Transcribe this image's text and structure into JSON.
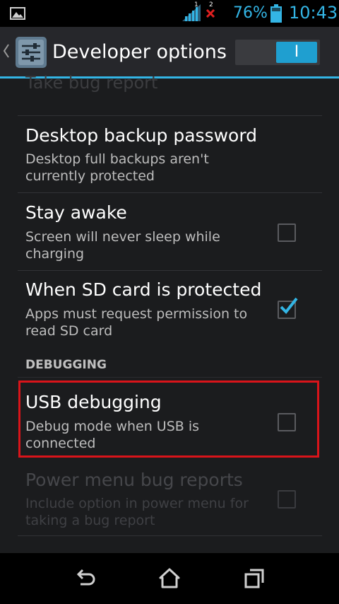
{
  "status_bar": {
    "signal_badge": "1",
    "no_signal_badge": "2",
    "battery_percent": "76%",
    "time": "10:43",
    "accent_color": "#33b5e5"
  },
  "action_bar": {
    "title": "Developer options",
    "master_switch": {
      "label": "I",
      "state": "on"
    }
  },
  "list": {
    "cut_off_title": "Take bug report",
    "items": [
      {
        "title": "Desktop backup password",
        "subtitle": "Desktop full backups aren't currently protected"
      },
      {
        "title": "Stay awake",
        "subtitle": "Screen will never sleep while charging",
        "checked": false
      },
      {
        "title": "When SD card is protected",
        "subtitle": "Apps must request permission to read SD card",
        "checked": true
      }
    ],
    "section_header": "DEBUGGING",
    "debug_items": [
      {
        "title": "USB debugging",
        "subtitle": "Debug mode when USB is connected",
        "checked": false,
        "highlighted": true
      },
      {
        "title": "Power menu bug reports",
        "subtitle": "Include option in power menu for taking a bug report",
        "checked": false,
        "enabled": false
      }
    ]
  },
  "nav_bar": {
    "icons": [
      "back-icon",
      "home-icon",
      "recent-apps-icon"
    ]
  }
}
